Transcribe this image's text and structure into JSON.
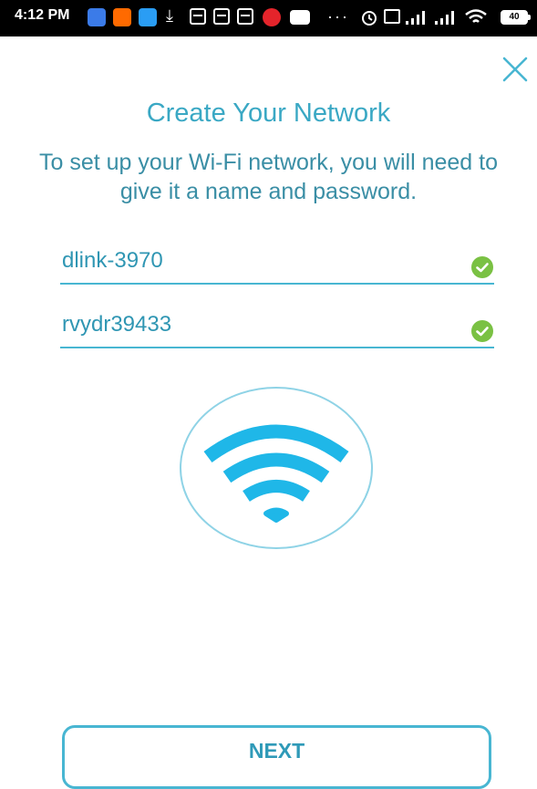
{
  "status_bar": {
    "time": "4:12 PM",
    "battery": "40",
    "overflow": "···",
    "icons": [
      "photos-icon",
      "mi-icon",
      "shortcut-icon",
      "download-icon",
      "app-icon",
      "app-icon",
      "app-icon",
      "jio-icon",
      "youtube-icon",
      "alarm-icon",
      "volte-icon",
      "signal-icon",
      "signal-icon",
      "wifi-icon",
      "battery-icon"
    ]
  },
  "screen": {
    "title": "Create Your Network",
    "subtitle": "To set up your Wi-Fi network, you will need to give it a name and password."
  },
  "form": {
    "network_name": "dlink-3970",
    "password": "rvydr39433"
  },
  "actions": {
    "next_label": "NEXT"
  },
  "colors": {
    "accent": "#3aa8c4",
    "check": "#7ac143",
    "wifi": "#1fb7e8"
  }
}
